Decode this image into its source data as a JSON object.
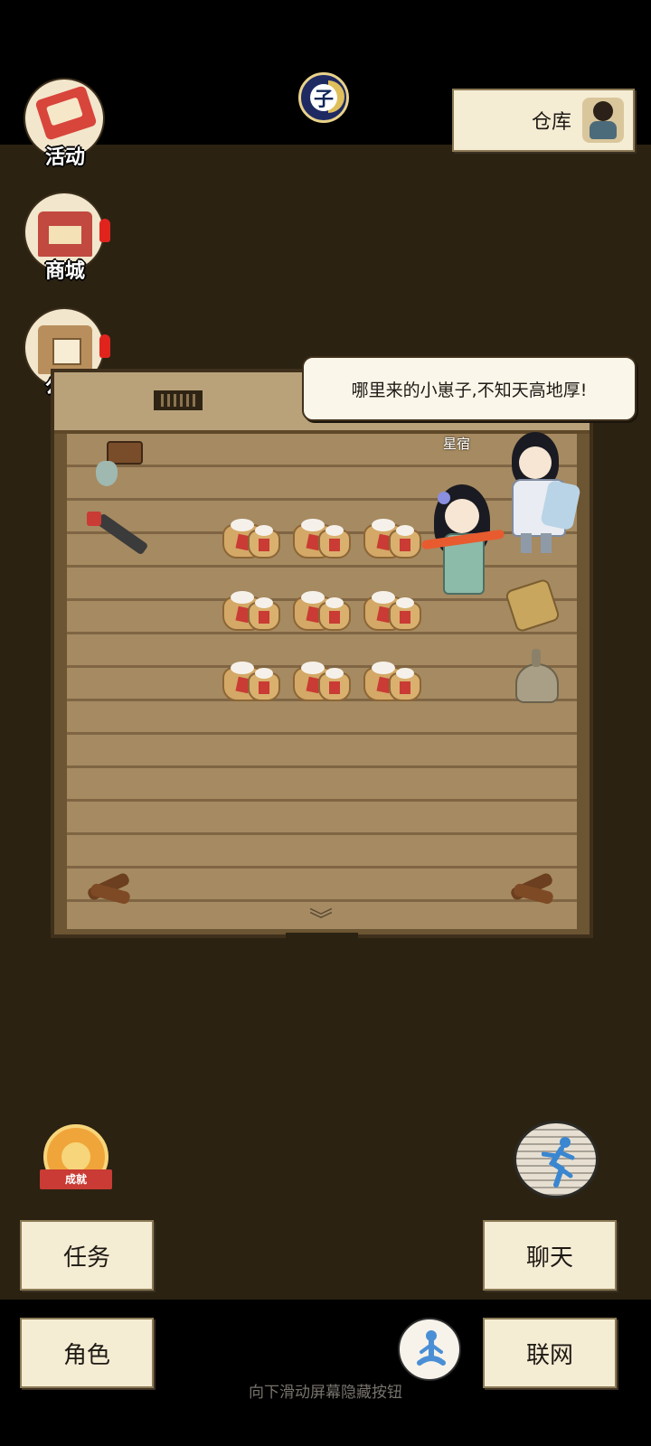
{
  "header": {
    "time_char": "子",
    "warehouse_label": "仓库"
  },
  "side_menu": {
    "activity": "活动",
    "shop": "商城",
    "notice": "公告"
  },
  "scene": {
    "dialog": "哪里来的小崽子,不知天高地厚!",
    "character_name": "星宿"
  },
  "bottom": {
    "achievement_label": "成就",
    "task": "任务",
    "chat": "聊天",
    "role": "角色",
    "network": "联网",
    "hint": "向下滑动屏幕隐藏按钮"
  },
  "colors": {
    "background": "#2b2212",
    "panel": "#f5ecd4",
    "alert": "#e0241d"
  },
  "icons": [
    "moon-time-icon",
    "warehouse-avatar-icon",
    "activity-icon",
    "shop-icon",
    "notice-icon",
    "achievement-icon",
    "run-icon",
    "meditate-icon",
    "exit-chevron-icon"
  ]
}
